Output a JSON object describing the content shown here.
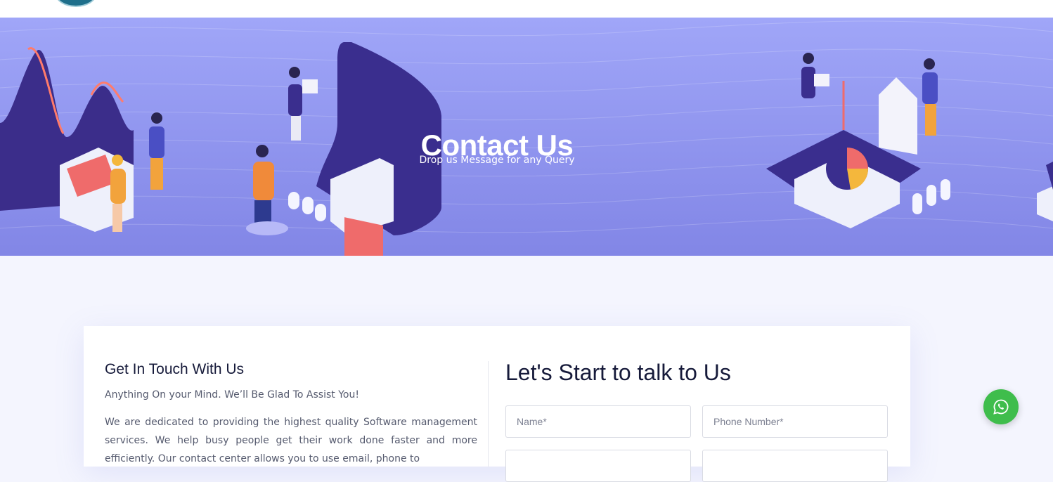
{
  "hero": {
    "title": "Contact Us",
    "subtitle": "Drop us Message for any Query"
  },
  "info": {
    "title": "Get In Touch With Us",
    "subtitle": "Anything On your Mind. We’ll Be Glad To Assist You!",
    "body": "We are dedicated to providing the highest quality Software management services. We help busy people get their work done faster and more efficiently. Our contact center allows you to use email, phone to"
  },
  "form": {
    "title": "Let's Start to talk to Us",
    "name_placeholder": "Name*",
    "phone_placeholder": "Phone Number*",
    "email_placeholder": "",
    "subject_placeholder": ""
  },
  "colors": {
    "hero": "#8f94ee",
    "heading": "#161a3a",
    "whatsapp": "#3fbd4c"
  },
  "icons": {
    "whatsapp": "whatsapp-icon",
    "logo": "site-logo"
  }
}
